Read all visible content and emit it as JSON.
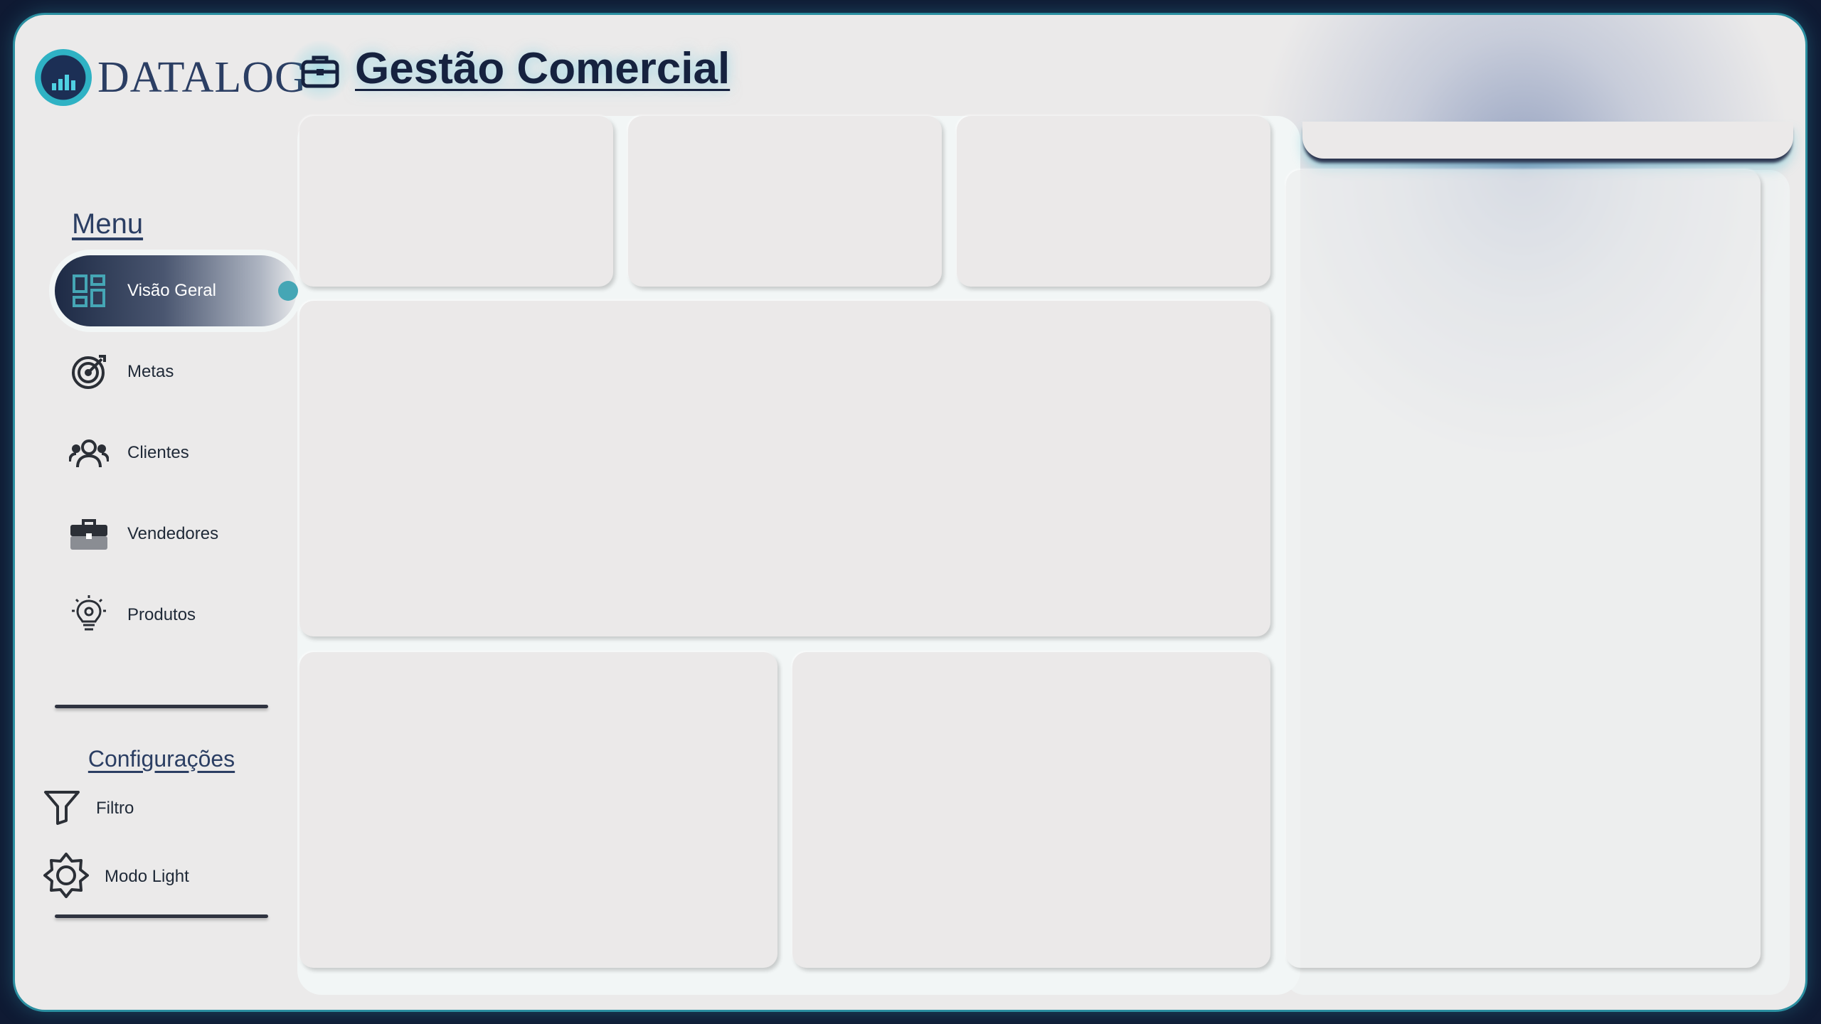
{
  "brand": {
    "name": "DATALOG"
  },
  "header": {
    "title": "Gestão Comercial",
    "icon": "briefcase-icon"
  },
  "sidebar": {
    "menu_title": "Menu",
    "items": [
      {
        "label": "Visão Geral",
        "icon": "dashboard-icon",
        "active": true
      },
      {
        "label": "Metas",
        "icon": "target-icon"
      },
      {
        "label": "Clientes",
        "icon": "users-icon"
      },
      {
        "label": "Vendedores",
        "icon": "briefcase-icon"
      },
      {
        "label": "Produtos",
        "icon": "lightbulb-gear-icon"
      }
    ],
    "config_title": "Configurações",
    "config_items": [
      {
        "label": "Filtro",
        "icon": "filter-icon"
      },
      {
        "label": "Modo Light",
        "icon": "gear-icon"
      }
    ]
  },
  "colors": {
    "accent": "#45a6b5",
    "navy": "#16223f",
    "background": "#ebeaea"
  }
}
